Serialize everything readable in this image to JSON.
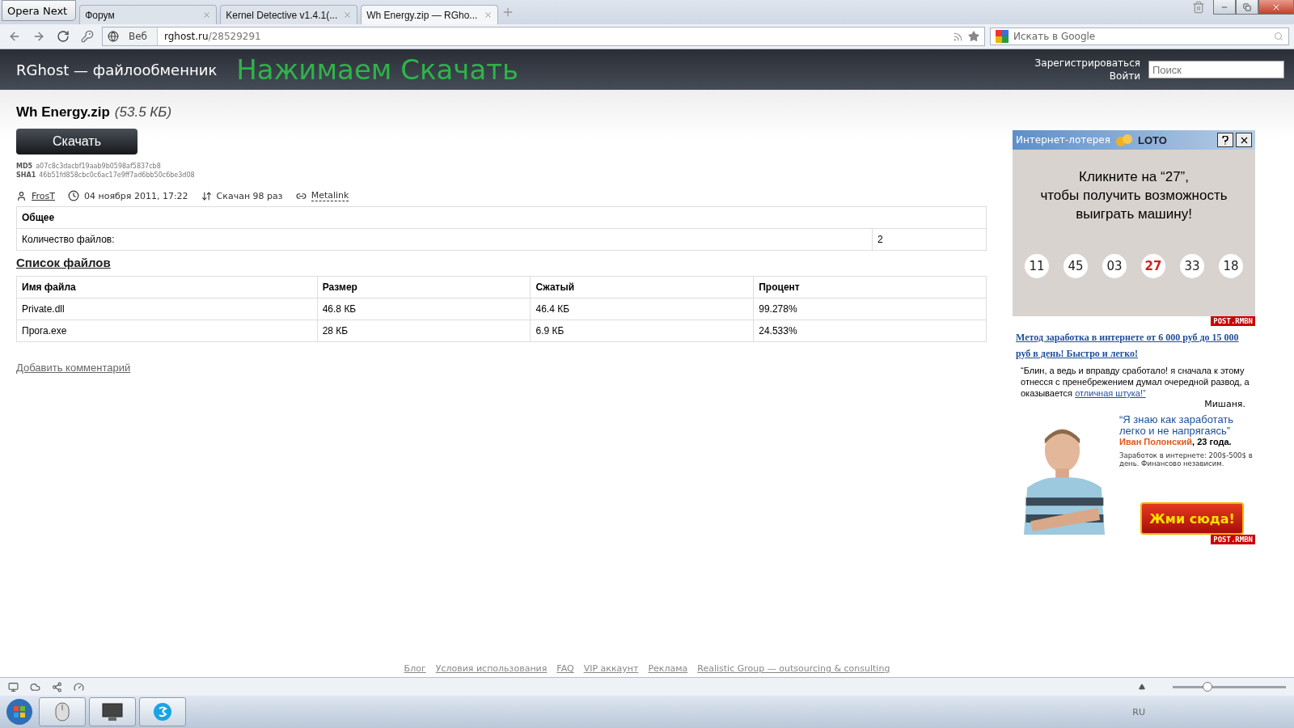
{
  "browser": {
    "menu_button": "Opera Next",
    "tabs": [
      {
        "label": "Форум",
        "selected": false
      },
      {
        "label": "Kernel Detective v1.4.1(...",
        "selected": false
      },
      {
        "label": "Wh Energy.zip — RGho...",
        "selected": true
      }
    ],
    "address": {
      "scope": "Веб",
      "host": "rghost.ru",
      "path": "/28529291"
    },
    "search": {
      "placeholder": "Искать в Google"
    }
  },
  "caption": "Нажимаем Скачать",
  "site": {
    "title": "RGhost — файлообменник",
    "register": "Зарегистрироваться",
    "login": "Войти",
    "search": {
      "placeholder": "Поиск"
    }
  },
  "file": {
    "name": "Wh Energy.zip",
    "size": "(53.5 КБ)",
    "download": "Скачать",
    "hashes": [
      {
        "label": "MD5",
        "value": "a07c8c3dacbf19aab9b0598af5837cb8"
      },
      {
        "label": "SHA1",
        "value": "46b51fd858cbc0c6ac17e9ff7ad6bb50c6be3d08"
      }
    ],
    "meta": {
      "author": "FrosT",
      "date": "04 ноября 2011, 17:22",
      "downloads": "Скачан 98 раз",
      "metalink": "Metalink"
    }
  },
  "general": {
    "heading": "Общее",
    "rows": [
      {
        "label": "Количество файлов:",
        "value": "2"
      }
    ]
  },
  "files": {
    "heading": "Список файлов",
    "columns": [
      "Имя файла",
      "Размер",
      "Сжатый",
      "Процент"
    ],
    "rows": [
      [
        "Private.dll",
        "46.8 КБ",
        "46.4 КБ",
        "99.278%"
      ],
      [
        "Прога.exe",
        "28 КБ",
        "6.9 КБ",
        "24.533%"
      ]
    ]
  },
  "add_comment": "Добавить комментарий",
  "ad": {
    "title": "Интернет-лотерея",
    "brand": "LOTO",
    "prompt": "Кликните на “27”,\nчтобы получить возможность\nвыиграть машину!",
    "balls": [
      {
        "label": "11",
        "selected": false
      },
      {
        "label": "45",
        "selected": false
      },
      {
        "label": "03",
        "selected": false
      },
      {
        "label": "27",
        "selected": true
      },
      {
        "label": "33",
        "selected": false
      },
      {
        "label": "18",
        "selected": false
      }
    ],
    "tag": "POST.RMBN",
    "headline": "Метод заработка в интернете от 6 000 руб до 15 000 руб в день! Быстро и легко!",
    "quote": "“Блин, а ведь и вправду сработало! я сначала к этому отнесся с пренебрежением думал очередной развод, а оказывается ",
    "quote_link": "отличная штука!”",
    "quote_author": "Мишаня.",
    "slogan": "“Я знаю как заработать легко и не напрягаясь”",
    "person": "Иван Полонский",
    "age": ", 23 года.",
    "note": "Заработок в интернете: 200$-500$ в день. Финансово независим.",
    "cta": "Жми сюда!",
    "cta_tag": "POST.RMBN"
  },
  "footer": [
    "Блог",
    "Условия использования",
    "FAQ",
    "VIP аккаунт",
    "Реклама",
    "Realistic Group — outsourcing & consulting"
  ],
  "status_bar": {
    "zoom_slider": {
      "level": 0.3
    }
  },
  "taskbar": {
    "language": "RU"
  }
}
